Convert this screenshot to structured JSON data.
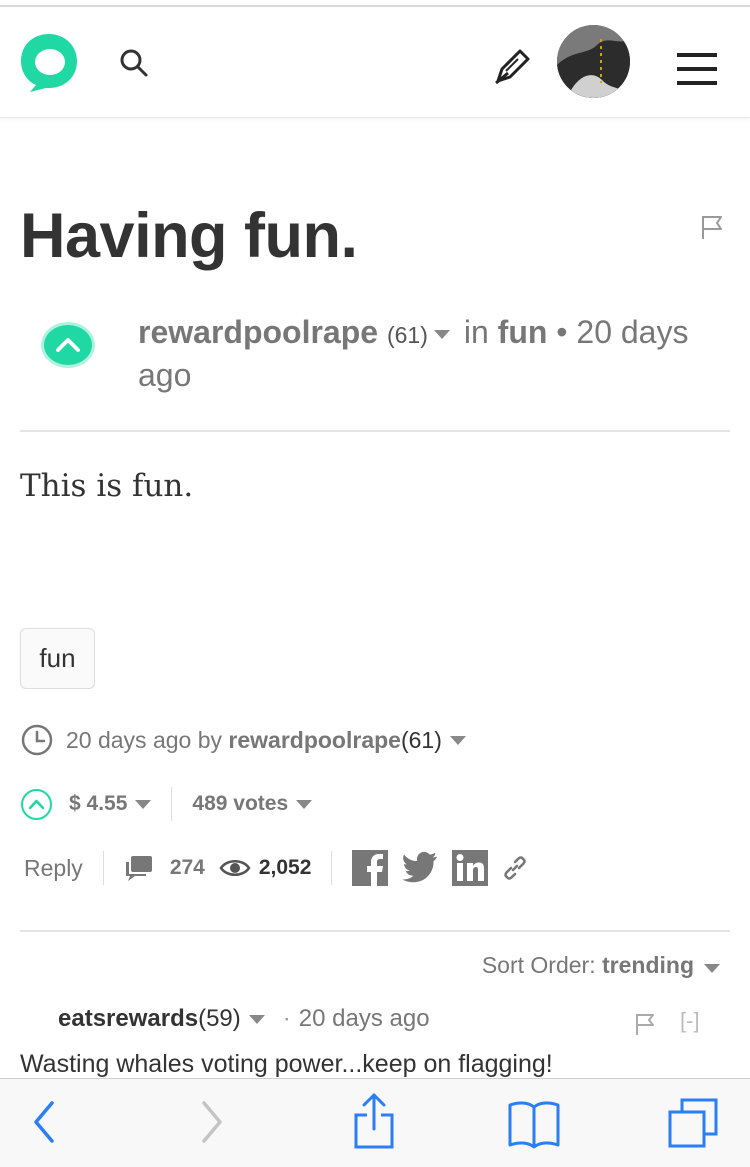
{
  "header": {
    "logo_icon": "steemit-logo-icon",
    "search_icon": "search-icon",
    "compose_icon": "pen-icon",
    "avatar_icon": "user-avatar",
    "menu_icon": "hamburger-menu-icon",
    "accent_color": "#1fd8a3"
  },
  "post": {
    "title": "Having fun.",
    "author": "rewardpoolrape",
    "author_rep": "(61)",
    "in_label": "in",
    "category": "fun",
    "bullet": "•",
    "time_ago": "20 days ago",
    "body": "This is fun.",
    "tags": [
      "fun"
    ]
  },
  "footer": {
    "time_ago": "20 days ago",
    "by_label": "by",
    "author": "rewardpoolrape",
    "author_rep": "(61)",
    "payout": "$ 4.55",
    "votes": "489 votes",
    "reply_label": "Reply",
    "comment_count": "274",
    "view_count": "2,052",
    "share_icons": [
      "facebook-icon",
      "twitter-icon",
      "linkedin-icon",
      "link-icon"
    ]
  },
  "comments": {
    "sort_label": "Sort Order:",
    "sort_value": "trending",
    "items": [
      {
        "author": "eatsrewards",
        "rep": "(59)",
        "dot": "·",
        "time_ago": "20 days ago",
        "collapse_label": "[-]",
        "body": "Wasting whales voting power...keep on flagging!"
      }
    ]
  },
  "browser_toolbar": {
    "icons": [
      "back-icon",
      "forward-icon",
      "share-icon",
      "bookmarks-icon",
      "tabs-icon"
    ],
    "tint_color": "#2a7ef6"
  }
}
